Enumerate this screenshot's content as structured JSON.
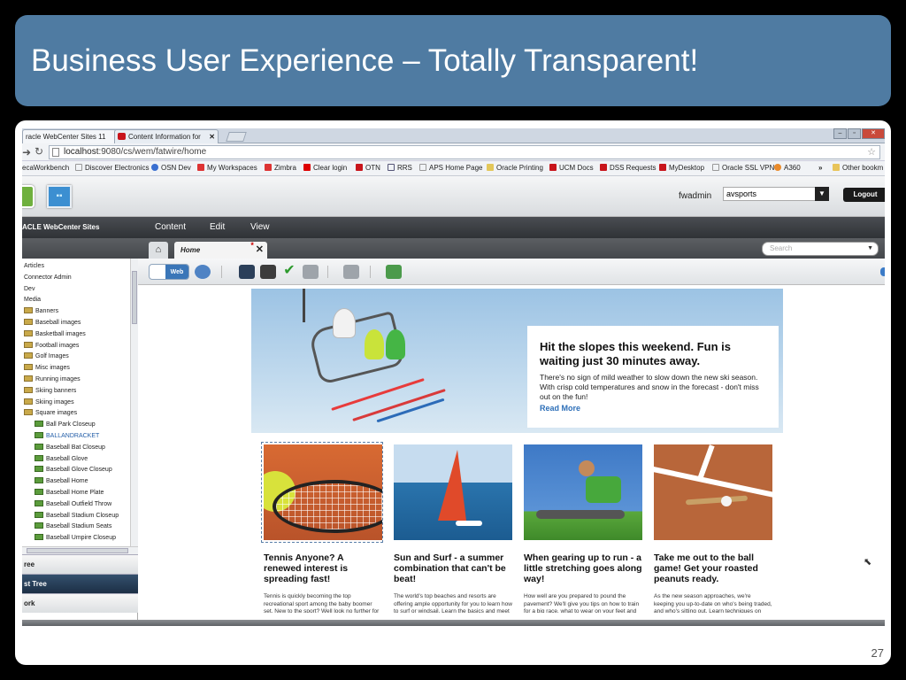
{
  "slide": {
    "title": "Business User Experience – Totally Transparent!",
    "page_number": "27"
  },
  "browser": {
    "tabs": [
      {
        "label": "racle WebCenter Sites 11",
        "active": true
      },
      {
        "label": "Content Information for",
        "active": false
      }
    ],
    "url_host": "localhost",
    "url_path": ":9080/cs/wem/fatwire/home",
    "bookmarks": [
      "ecaWorkbench",
      "Discover Electronics",
      "OSN Dev",
      "My Workspaces",
      "Zimbra",
      "Clear login",
      "OTN",
      "RRS",
      "APS Home Page",
      "Oracle Printing",
      "UCM Docs",
      "DSS Requests",
      "MyDesktop",
      "Oracle SSL VPN",
      "A360",
      "»",
      "Other bookm"
    ]
  },
  "app": {
    "username": "fwadmin",
    "site": "avsports",
    "logout_label": "Logout",
    "logo_text": "ACLE  WebCenter Sites",
    "menu": [
      "Content",
      "Edit",
      "View"
    ],
    "doc_tab": "Home",
    "search_placeholder": "Search",
    "web_toggle": "Web"
  },
  "tree": {
    "items": [
      {
        "label": "Articles",
        "type": "plain"
      },
      {
        "label": "Connector Admin",
        "type": "plain"
      },
      {
        "label": "Dev",
        "type": "plain"
      },
      {
        "label": "Media",
        "type": "plain"
      },
      {
        "label": "Banners",
        "type": "folder"
      },
      {
        "label": "Baseball images",
        "type": "folder"
      },
      {
        "label": "Basketball images",
        "type": "folder"
      },
      {
        "label": "Football images",
        "type": "folder"
      },
      {
        "label": "Golf Images",
        "type": "folder"
      },
      {
        "label": "Misc images",
        "type": "folder"
      },
      {
        "label": "Running images",
        "type": "folder"
      },
      {
        "label": "Skiing banners",
        "type": "folder"
      },
      {
        "label": "Skiing images",
        "type": "folder"
      },
      {
        "label": "Square images",
        "type": "folder"
      },
      {
        "label": "Ball Park Closeup",
        "type": "image"
      },
      {
        "label": "BALLANDRACKET",
        "type": "image",
        "selected": true
      },
      {
        "label": "Baseball Bat Closeup",
        "type": "image"
      },
      {
        "label": "Baseball Glove",
        "type": "image"
      },
      {
        "label": "Baseball Glove Closeup",
        "type": "image"
      },
      {
        "label": "Baseball Home",
        "type": "image"
      },
      {
        "label": "Baseball Home Plate",
        "type": "image"
      },
      {
        "label": "Baseball Outfield Throw",
        "type": "image"
      },
      {
        "label": "Baseball Stadium Closeup",
        "type": "image"
      },
      {
        "label": "Baseball Stadium Seats",
        "type": "image"
      },
      {
        "label": "Baseball Umpire Closeup",
        "type": "image"
      }
    ],
    "scroll_label": "III",
    "accordions": [
      {
        "label": "ree",
        "active": false
      },
      {
        "label": "st Tree",
        "active": true
      },
      {
        "label": "ork",
        "active": false
      }
    ]
  },
  "hero": {
    "heading": "Hit the slopes this weekend. Fun is waiting just 30 minutes away.",
    "body": "There's no sign of mild weather to slow down the new ski season.  With crisp cold temperatures and snow in the forecast - don't miss out on the fun!",
    "link": "Read More"
  },
  "cards": [
    {
      "title": "Tennis Anyone? A renewed interest is spreading fast!",
      "desc": "Tennis is quickly becoming the top recreational sport among the baby boomer set. New to the sport? Well look no further for information on how to play and who..."
    },
    {
      "title": "Sun and Surf - a summer combination that can't be beat!",
      "desc": "The world's top beaches and resorts are offering ample opportunity for you to learn how to surf or windsail.  Learn the basics and meet the pros that reign from coast..."
    },
    {
      "title": "When gearing up to run - a little stretching goes along way!",
      "desc": "How well are you prepared to pound the pavement? We'll give you tips on how to train for a big race, what to wear on your feet and how to watch at this year's..."
    },
    {
      "title": "Take me out to the ball game! Get your roasted peanuts ready.",
      "desc": "As the new season approaches, we're keeping you up-to-date on who's being traded, and who's sitting out. Learn techniques on how to improve your swing..."
    }
  ],
  "colors": {
    "header_bg": "#4f7ba2",
    "accent_blue": "#2d6fb8",
    "logout_bg": "#1a1a1a"
  }
}
